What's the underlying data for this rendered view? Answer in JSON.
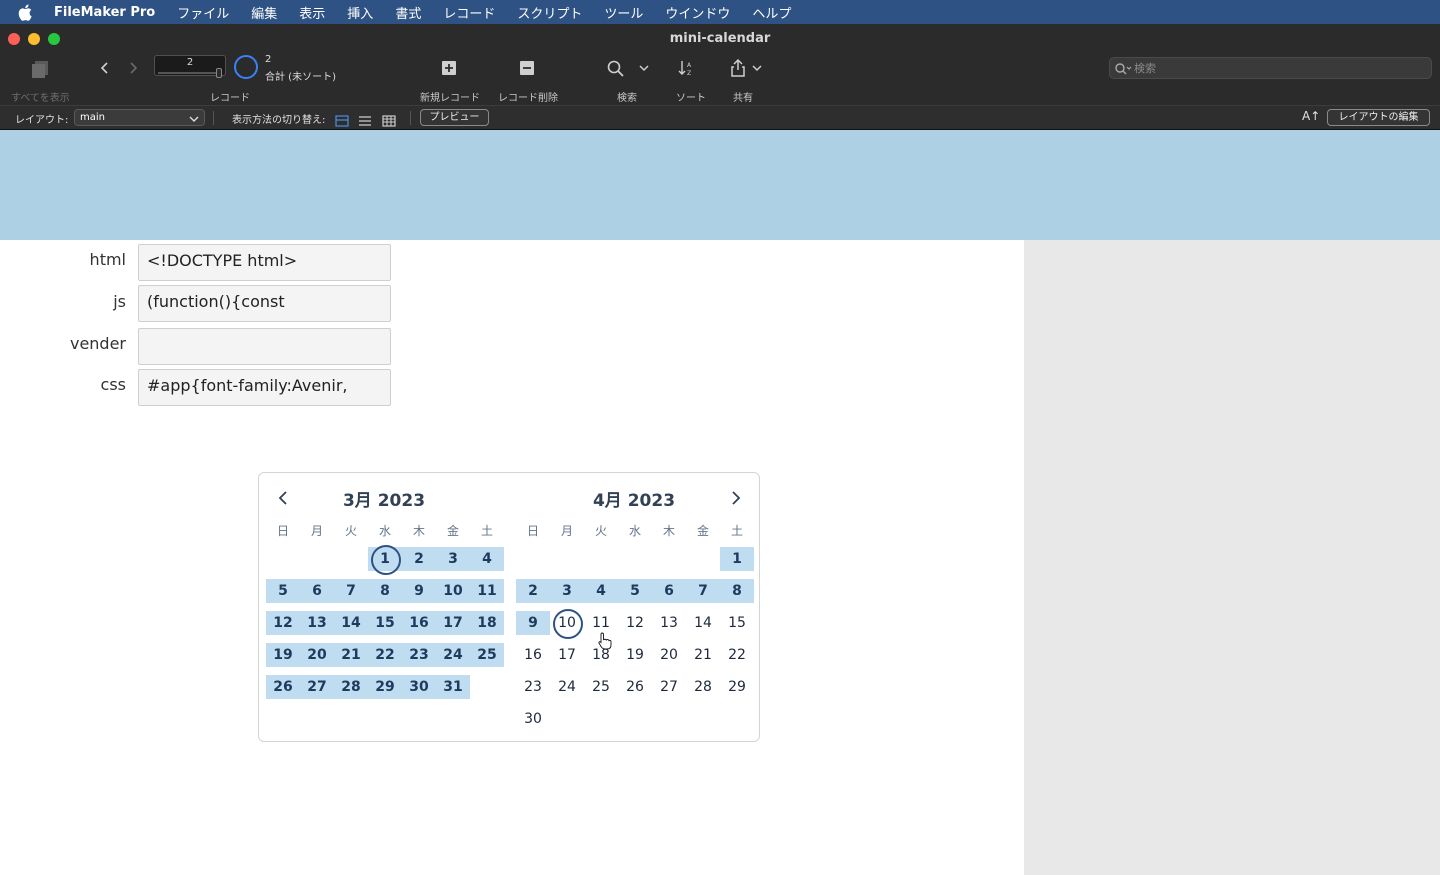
{
  "menubar": {
    "apple_icon": "apple-icon",
    "items": [
      "FileMaker Pro",
      "ファイル",
      "編集",
      "表示",
      "挿入",
      "書式",
      "レコード",
      "スクリプト",
      "ツール",
      "ウインドウ",
      "ヘルプ"
    ]
  },
  "window": {
    "title": "mini-calendar"
  },
  "toolbar": {
    "show_all": "すべてを表示",
    "records_label": "レコード",
    "current_record": "2",
    "record_count": "2",
    "record_total": "合計 (未ソート)",
    "new_record": "新規レコード",
    "delete_record": "レコード削除",
    "find": "検索",
    "sort": "ソート",
    "share": "共有",
    "search_placeholder": "検索"
  },
  "layoutbar": {
    "layout_label": "レイアウト:",
    "layout_value": "main",
    "view_as_label": "表示方法の切り替え:",
    "preview_button": "プレビュー",
    "edit_layout_button": "レイアウトの編集",
    "font_size_icon": "A↑"
  },
  "fields": [
    {
      "label": "html",
      "value": "<!DOCTYPE html>"
    },
    {
      "label": "js",
      "value": "(function(){const"
    },
    {
      "label": "vender",
      "value": ""
    },
    {
      "label": "css",
      "value": "#app{font-family:Avenir,"
    }
  ],
  "calendar": {
    "left_title": "3月 2023",
    "right_title": "4月 2023",
    "weekdays": [
      "日",
      "月",
      "火",
      "水",
      "木",
      "金",
      "土"
    ],
    "march": {
      "first_weekday": 3,
      "days": 31,
      "selected_from": 1,
      "selected_to": 31,
      "circled": 1
    },
    "april": {
      "first_weekday": 6,
      "days": 30,
      "selected_from": 1,
      "selected_to": 9,
      "circled": 10
    }
  },
  "colors": {
    "menubar": "#2d5283",
    "header_band": "#aed0e4",
    "selected_day": "#bfdcf0",
    "today_ring": "#2d5283"
  }
}
